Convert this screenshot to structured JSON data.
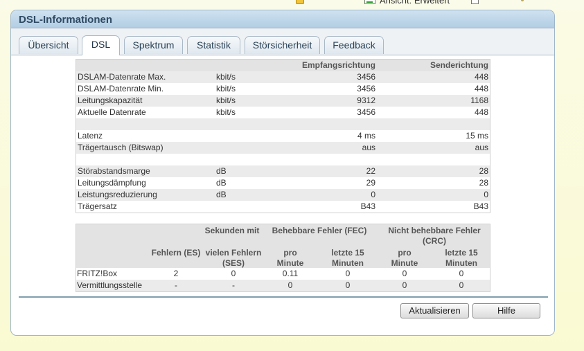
{
  "toolbar": {
    "cut_text": "Ansicht: Erweitert"
  },
  "panel": {
    "title": "DSL-Informationen"
  },
  "tabs": [
    {
      "label": "Übersicht",
      "active": false
    },
    {
      "label": "DSL",
      "active": true
    },
    {
      "label": "Spektrum",
      "active": false
    },
    {
      "label": "Statistik",
      "active": false
    },
    {
      "label": "Störsicherheit",
      "active": false
    },
    {
      "label": "Feedback",
      "active": false
    }
  ],
  "rates_table": {
    "headers": {
      "rx": "Empfangsrichtung",
      "tx": "Senderichtung"
    },
    "rows": [
      {
        "label": "DSLAM-Datenrate Max.",
        "unit": "kbit/s",
        "rx": "3456",
        "tx": "448"
      },
      {
        "label": "DSLAM-Datenrate Min.",
        "unit": "kbit/s",
        "rx": "3456",
        "tx": "448"
      },
      {
        "label": "Leitungskapazität",
        "unit": "kbit/s",
        "rx": "9312",
        "tx": "1168"
      },
      {
        "label": "Aktuelle Datenrate",
        "unit": "kbit/s",
        "rx": "3456",
        "tx": "448"
      },
      {
        "label": "",
        "unit": "",
        "rx": "",
        "tx": ""
      },
      {
        "label": "Latenz",
        "unit": "",
        "rx": "4 ms",
        "tx": "15 ms"
      },
      {
        "label": "Trägertausch (Bitswap)",
        "unit": "",
        "rx": "aus",
        "tx": "aus"
      },
      {
        "label": "",
        "unit": "",
        "rx": "",
        "tx": ""
      },
      {
        "label": "Störabstandsmarge",
        "unit": "dB",
        "rx": "22",
        "tx": "28"
      },
      {
        "label": "Leitungsdämpfung",
        "unit": "dB",
        "rx": "29",
        "tx": "28"
      },
      {
        "label": "Leistungsreduzierung",
        "unit": "dB",
        "rx": "0",
        "tx": "0"
      },
      {
        "label": "Trägersatz",
        "unit": "",
        "rx": "B43",
        "tx": "B43"
      }
    ]
  },
  "errors_table": {
    "group_headers": {
      "seconds": "Sekunden mit",
      "fec": "Behebbare Fehler (FEC)",
      "crc": "Nicht behebbare Fehler (CRC)"
    },
    "sub_headers": {
      "es": "Fehlern (ES)",
      "ses": "vielen Fehlern (SES)",
      "fec_min": "pro Minute",
      "fec_15": "letzte 15 Minuten",
      "crc_min": "pro Minute",
      "crc_15": "letzte 15 Minuten"
    },
    "rows": [
      {
        "label": "FRITZ!Box",
        "es": "2",
        "ses": "0",
        "fec_min": "0.11",
        "fec_15": "0",
        "crc_min": "0",
        "crc_15": "0"
      },
      {
        "label": "Vermittlungsstelle",
        "es": "-",
        "ses": "-",
        "fec_min": "0",
        "fec_15": "0",
        "crc_min": "0",
        "crc_15": "0"
      }
    ]
  },
  "buttons": {
    "refresh": "Aktualisieren",
    "help": "Hilfe"
  }
}
